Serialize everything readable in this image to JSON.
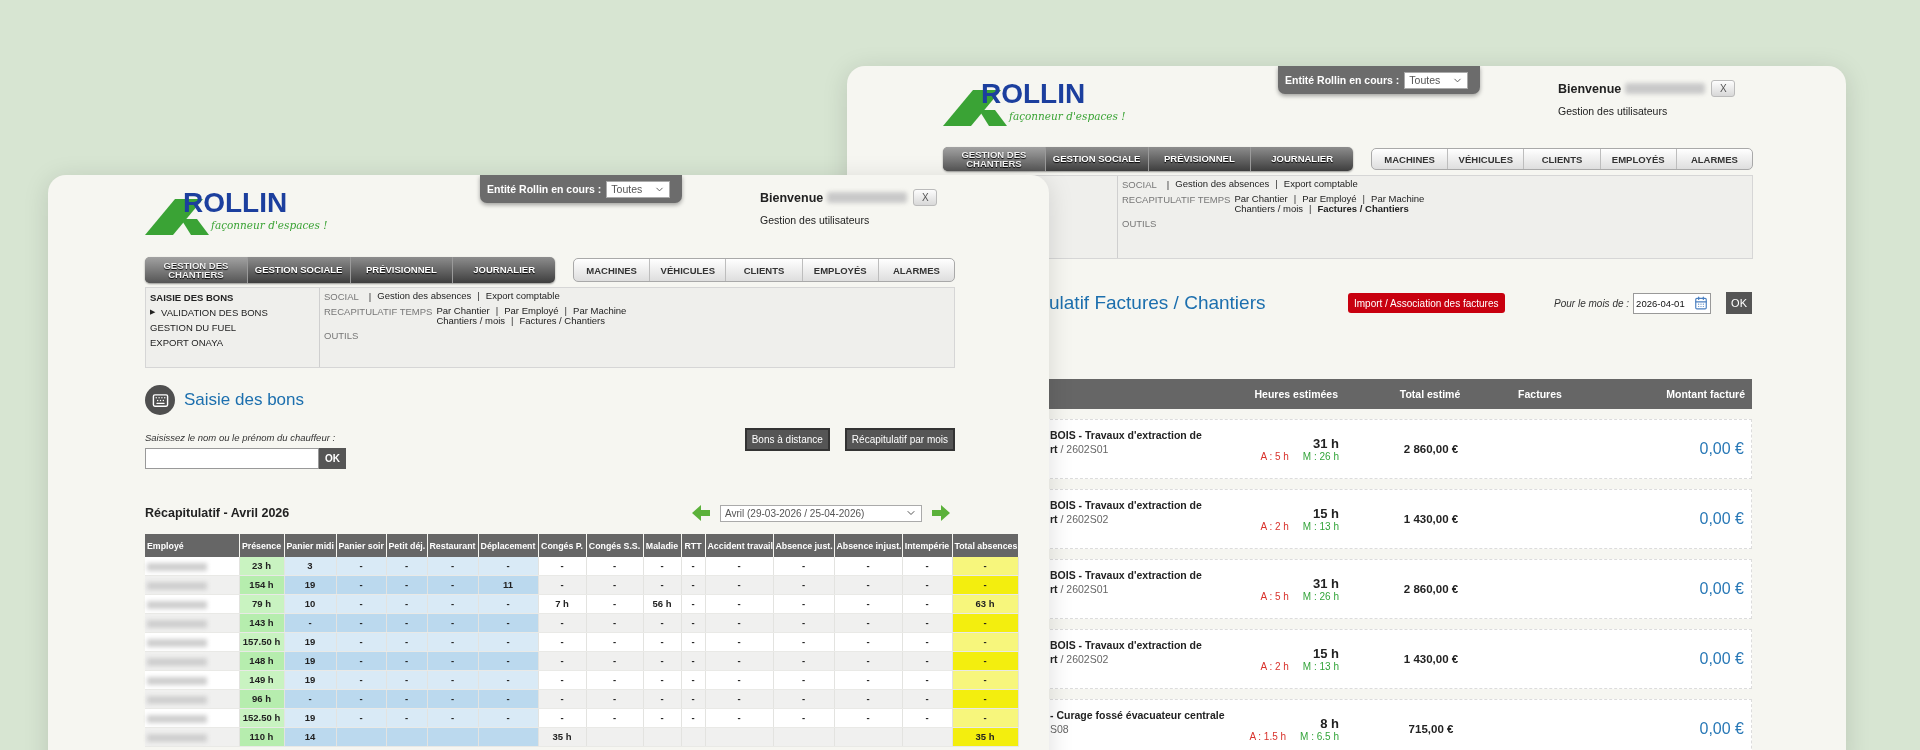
{
  "back_window": {
    "logo": {
      "name": "ROLLIN",
      "tagline": "façonneur d'espaces !"
    },
    "entity": {
      "label": "Entité Rollin en cours :",
      "value": "Toutes"
    },
    "welcome": {
      "greeting": "Bienvenue",
      "close": "X",
      "link": "Gestion des utilisateurs"
    },
    "main_nav": [
      {
        "label": "GESTION DES CHANTIERS",
        "selected": true
      },
      {
        "label": "GESTION SOCIALE",
        "selected": false
      },
      {
        "label": "PRÉVISIONNEL",
        "selected": false
      },
      {
        "label": "JOURNALIER",
        "selected": false
      }
    ],
    "secondary_nav": [
      "MACHINES",
      "VÉHICULES",
      "CLIENTS",
      "EMPLOYÉS",
      "ALARMES"
    ],
    "submenu": {
      "separator": "|",
      "groups": [
        {
          "label": "SOCIAL",
          "label_separator": "|",
          "lines": [
            [
              {
                "text": "Gestion des absences",
                "selected": false
              },
              {
                "text": "Export comptable",
                "selected": false
              }
            ]
          ]
        },
        {
          "label": "RECAPITULATIF TEMPS",
          "lines": [
            [
              {
                "text": "Par Chantier",
                "selected": false
              },
              {
                "text": "Par Employé",
                "selected": false
              },
              {
                "text": "Par Machine",
                "selected": false
              }
            ],
            [
              {
                "text": "Chantiers / mois",
                "selected": false
              },
              {
                "text": "Factures / Chantiers",
                "selected": true
              }
            ]
          ]
        },
        {
          "label": "OUTILS"
        }
      ]
    },
    "page_title": "ulatif Factures / Chantiers",
    "import_button": "Import / Association des factures",
    "month": {
      "label": "Pour le mois de :",
      "value": "2026-04-01",
      "button": "OK"
    },
    "table": {
      "columns": [
        "Heures estimées",
        "Total estimé",
        "Factures",
        "Montant facturé"
      ],
      "rows": [
        {
          "title": "BOIS - Travaux d'extraction de",
          "ref": "**rt** / 2602S01",
          "hours": "31 h",
          "hours_a": "A : 5 h",
          "hours_m": "M : 26 h",
          "total": "2 860,00 €",
          "billed": "0,00 €"
        },
        {
          "title": "BOIS - Travaux d'extraction de",
          "ref": "**rt** / 2602S02",
          "hours": "15 h",
          "hours_a": "A : 2 h",
          "hours_m": "M : 13 h",
          "total": "1 430,00 €",
          "billed": "0,00 €"
        },
        {
          "title": "BOIS - Travaux d'extraction de",
          "ref": "**rt** / 2602S01",
          "hours": "31 h",
          "hours_a": "A : 5 h",
          "hours_m": "M : 26 h",
          "total": "2 860,00 €",
          "billed": "0,00 €"
        },
        {
          "title": "BOIS - Travaux d'extraction de",
          "ref": "**rt** / 2602S02",
          "hours": "15 h",
          "hours_a": "A : 2 h",
          "hours_m": "M : 13 h",
          "total": "1 430,00 €",
          "billed": "0,00 €"
        },
        {
          "title": "- Curage fossé évacuateur centrale",
          "ref": "S08",
          "hours": "8 h",
          "hours_a": "A : 1.5 h",
          "hours_m": "M : 6.5 h",
          "total": "715,00 €",
          "billed": "0,00 €"
        }
      ]
    }
  },
  "front_window": {
    "logo": {
      "name": "ROLLIN",
      "tagline": "façonneur d'espaces !"
    },
    "entity": {
      "label": "Entité Rollin en cours :",
      "value": "Toutes"
    },
    "welcome": {
      "greeting": "Bienvenue",
      "close": "X",
      "link": "Gestion des utilisateurs"
    },
    "main_nav": [
      {
        "label": "GESTION DES CHANTIERS",
        "selected": true
      },
      {
        "label": "GESTION SOCIALE",
        "selected": false
      },
      {
        "label": "PRÉVISIONNEL",
        "selected": false
      },
      {
        "label": "JOURNALIER",
        "selected": false
      }
    ],
    "secondary_nav": [
      "MACHINES",
      "VÉHICULES",
      "CLIENTS",
      "EMPLOYÉS",
      "ALARMES"
    ],
    "submenu": {
      "separator": "|",
      "items": [
        {
          "label": "SAISIE DES BONS",
          "selected": true
        },
        {
          "label": "VALIDATION DES BONS",
          "selected": false,
          "marker": "▶"
        },
        {
          "label": "GESTION DU FUEL",
          "selected": false
        },
        {
          "label": "EXPORT ONAYA",
          "selected": false
        }
      ],
      "groups": [
        {
          "label": "SOCIAL",
          "label_separator": "|",
          "lines": [
            [
              {
                "text": "Gestion des absences",
                "selected": false
              },
              {
                "text": "Export comptable",
                "selected": false
              }
            ]
          ]
        },
        {
          "label": "RECAPITULATIF TEMPS",
          "lines": [
            [
              {
                "text": "Par Chantier",
                "selected": false
              },
              {
                "text": "Par Employé",
                "selected": false
              },
              {
                "text": "Par Machine",
                "selected": false
              }
            ],
            [
              {
                "text": "Chantiers / mois",
                "selected": false
              },
              {
                "text": "Factures / Chantiers",
                "selected": false
              }
            ]
          ]
        },
        {
          "label": "OUTILS"
        }
      ]
    },
    "page_title": "Saisie des bons",
    "search": {
      "label": "Saisissez le nom ou le prénom du chauffeur :",
      "button": "OK"
    },
    "actions": [
      "Bons à distance",
      "Récapitulatif par mois"
    ],
    "summary": {
      "title": "Récapitulatif - Avril 2026",
      "period": "Avril (29-03-2026 / 25-04-2026)",
      "name_column": "Employé",
      "columns": [
        {
          "label": "Présence",
          "kind": "presence"
        },
        {
          "label": "Panier midi",
          "kind": "meal"
        },
        {
          "label": "Panier soir",
          "kind": "meal"
        },
        {
          "label": "Petit déj.",
          "kind": "meal"
        },
        {
          "label": "Restaurant",
          "kind": "meal"
        },
        {
          "label": "Déplacement",
          "kind": "meal"
        },
        {
          "label": "Congés P.",
          "kind": "absence"
        },
        {
          "label": "Congés S.S.",
          "kind": "absence"
        },
        {
          "label": "Maladie",
          "kind": "absence"
        },
        {
          "label": "RTT",
          "kind": "absence"
        },
        {
          "label": "Accident travail",
          "kind": "absence"
        },
        {
          "label": "Absence just.",
          "kind": "absence"
        },
        {
          "label": "Absence injust.",
          "kind": "absence"
        },
        {
          "label": "Intempérie",
          "kind": "absence"
        },
        {
          "label": "Total absences",
          "kind": "total"
        }
      ],
      "rows": [
        {
          "cells": [
            "23 h",
            "3",
            "-",
            "-",
            "-",
            "-",
            "-",
            "-",
            "-",
            "-",
            "-",
            "-",
            "-",
            "-",
            "-"
          ]
        },
        {
          "cells": [
            "154 h",
            "19",
            "-",
            "-",
            "-",
            "11",
            "-",
            "-",
            "-",
            "-",
            "-",
            "-",
            "-",
            "-",
            "-"
          ]
        },
        {
          "cells": [
            "79 h",
            "10",
            "-",
            "-",
            "-",
            "-",
            "7 h",
            "-",
            "56 h",
            "-",
            "-",
            "-",
            "-",
            "-",
            "63 h"
          ]
        },
        {
          "cells": [
            "143 h",
            "-",
            "-",
            "-",
            "-",
            "-",
            "-",
            "-",
            "-",
            "-",
            "-",
            "-",
            "-",
            "-",
            "-"
          ]
        },
        {
          "cells": [
            "157.50 h",
            "19",
            "-",
            "-",
            "-",
            "-",
            "-",
            "-",
            "-",
            "-",
            "-",
            "-",
            "-",
            "-",
            "-"
          ]
        },
        {
          "cells": [
            "148 h",
            "19",
            "-",
            "-",
            "-",
            "-",
            "-",
            "-",
            "-",
            "-",
            "-",
            "-",
            "-",
            "-",
            "-"
          ]
        },
        {
          "cells": [
            "149 h",
            "19",
            "-",
            "-",
            "-",
            "-",
            "-",
            "-",
            "-",
            "-",
            "-",
            "-",
            "-",
            "-",
            "-"
          ]
        },
        {
          "cells": [
            "96 h",
            "-",
            "-",
            "-",
            "-",
            "-",
            "-",
            "-",
            "-",
            "-",
            "-",
            "-",
            "-",
            "-",
            "-"
          ]
        },
        {
          "cells": [
            "152.50 h",
            "19",
            "-",
            "-",
            "-",
            "-",
            "-",
            "-",
            "-",
            "-",
            "-",
            "-",
            "-",
            "-",
            "-"
          ]
        },
        {
          "cells": [
            "110 h",
            "14",
            null,
            null,
            null,
            null,
            "35 h",
            null,
            null,
            null,
            null,
            null,
            null,
            null,
            "35 h"
          ]
        }
      ]
    }
  }
}
